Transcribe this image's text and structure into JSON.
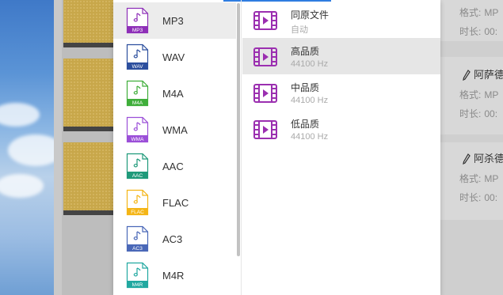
{
  "formats": [
    {
      "label": "MP3",
      "tag": "MP3",
      "color": "#8e2fb8",
      "selected": true
    },
    {
      "label": "WAV",
      "tag": "WAV",
      "color": "#2c4f9e",
      "selected": false
    },
    {
      "label": "M4A",
      "tag": "M4A",
      "color": "#3fae3a",
      "selected": false
    },
    {
      "label": "WMA",
      "tag": "WMA",
      "color": "#9b4fd8",
      "selected": false
    },
    {
      "label": "AAC",
      "tag": "AAC",
      "color": "#1f9a7a",
      "selected": false
    },
    {
      "label": "FLAC",
      "tag": "FLAC",
      "color": "#f4b516",
      "selected": false
    },
    {
      "label": "AC3",
      "tag": "AC3",
      "color": "#4a68b8",
      "selected": false
    },
    {
      "label": "M4R",
      "tag": "M4R",
      "color": "#21a8a0",
      "selected": false
    }
  ],
  "qualities": [
    {
      "title": "同原文件",
      "sub": "自动",
      "selected": false
    },
    {
      "title": "高品质",
      "sub": "44100 Hz",
      "selected": true
    },
    {
      "title": "中品质",
      "sub": "44100 Hz",
      "selected": false
    },
    {
      "title": "低品质",
      "sub": "44100 Hz",
      "selected": false
    }
  ],
  "cards": [
    {
      "title": "",
      "format_label": "格式:",
      "format_value": "MP",
      "duration_label": "时长:",
      "duration_value": "00:"
    },
    {
      "title": "阿萨德",
      "format_label": "格式:",
      "format_value": "MP",
      "duration_label": "时长:",
      "duration_value": "00:"
    },
    {
      "title": "阿杀德",
      "format_label": "格式:",
      "format_value": "MP",
      "duration_label": "时长:",
      "duration_value": "00:"
    }
  ],
  "colors": {
    "accent": "#2f7de1",
    "video_icon": "#9b2fb0"
  },
  "icons": {
    "format": "music-file-icon",
    "quality": "video-film-icon",
    "edit": "pencil-icon"
  }
}
